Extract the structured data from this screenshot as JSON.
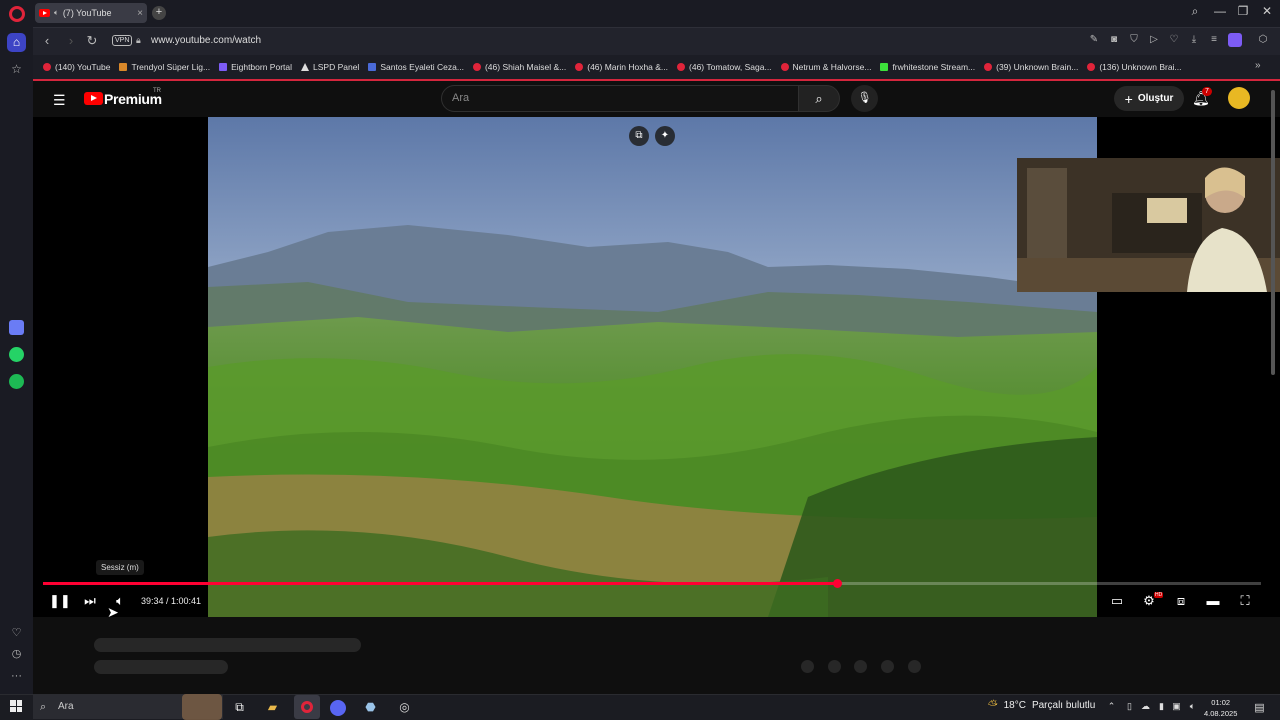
{
  "browser": {
    "tab_title": "(7) YouTube",
    "tab_close": "×",
    "new_tab": "+",
    "url": "www.youtube.com/watch",
    "vpn_badge": "VPN",
    "window_controls": {
      "search": "⌕",
      "minimize": "—",
      "restore": "❐",
      "close": "✕"
    },
    "nav": {
      "back": "‹",
      "forward": "›",
      "reload": "↻"
    },
    "bookmarks": [
      {
        "label": "(140) YouTube",
        "icon": "youtube-icon"
      },
      {
        "label": "Trendyol Süper Lig...",
        "icon": "trendyol-icon"
      },
      {
        "label": "Eightborn Portal",
        "icon": "eightborn-icon"
      },
      {
        "label": "LSPD Panel",
        "icon": "lspd-icon"
      },
      {
        "label": "Santos Eyaleti Ceza...",
        "icon": "document-icon"
      },
      {
        "label": "(46) Shiah Maisel &...",
        "icon": "youtube-icon"
      },
      {
        "label": "(46) Marin Hoxha &...",
        "icon": "youtube-icon"
      },
      {
        "label": "(46) Tomatow, Saga...",
        "icon": "youtube-icon"
      },
      {
        "label": "Netrum & Halvorse...",
        "icon": "youtube-icon"
      },
      {
        "label": "frwhitestone Stream...",
        "icon": "kick-icon"
      },
      {
        "label": "(39) Unknown Brain...",
        "icon": "youtube-icon"
      },
      {
        "label": "(136) Unknown Brai...",
        "icon": "youtube-icon"
      }
    ],
    "bookmarks_more": "»"
  },
  "youtube": {
    "brand": "Premium",
    "region": "TR",
    "search_placeholder": "Ara",
    "create_label": "Oluştur",
    "notification_count": "7",
    "menu_icon": "☰"
  },
  "player": {
    "tooltip": "Sessiz (m)",
    "current_time": "39:34",
    "duration": "1:00:41",
    "time_display": "39:34 / 1:00:41",
    "progress_fraction": 0.652,
    "hd_badge": "HD"
  },
  "taskbar": {
    "search_placeholder": "Ara",
    "temperature": "18°C",
    "weather": "Parçalı bulutlu",
    "time": "01:02",
    "date": "4.08.2025"
  },
  "colors": {
    "accent_red": "#ff0033",
    "opera_red": "#e0243a",
    "opera_sidebar_active": "#3d44c5"
  }
}
